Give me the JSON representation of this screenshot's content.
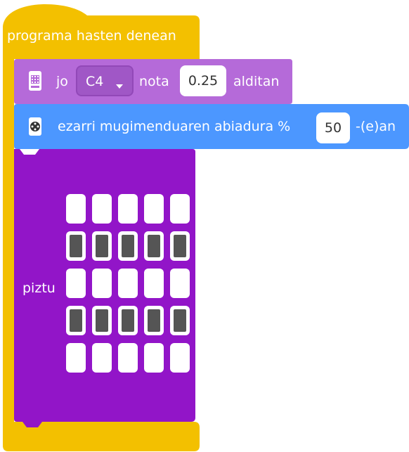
{
  "hat_block": {
    "label": "programa hasten denean",
    "color": "#f3c000"
  },
  "sound_block": {
    "icon": "microbit-icon",
    "label_play": "jo",
    "note_value": "C4",
    "label_note": "nota",
    "beat_value": "0.25",
    "label_beats": "alditan",
    "color": "#b56ad9"
  },
  "motor_block": {
    "icon": "servo-icon",
    "label": "ezarri mugimenduaren abiadura %",
    "speed_value": "50",
    "suffix": "-(e)an",
    "color": "#4c97ff"
  },
  "led_block": {
    "label": "piztu",
    "color": "#9215c8",
    "rows": [
      [
        false,
        false,
        false,
        false,
        false
      ],
      [
        true,
        true,
        true,
        true,
        true
      ],
      [
        false,
        false,
        false,
        false,
        false
      ],
      [
        true,
        true,
        true,
        true,
        true
      ],
      [
        false,
        false,
        false,
        false,
        false
      ]
    ]
  }
}
